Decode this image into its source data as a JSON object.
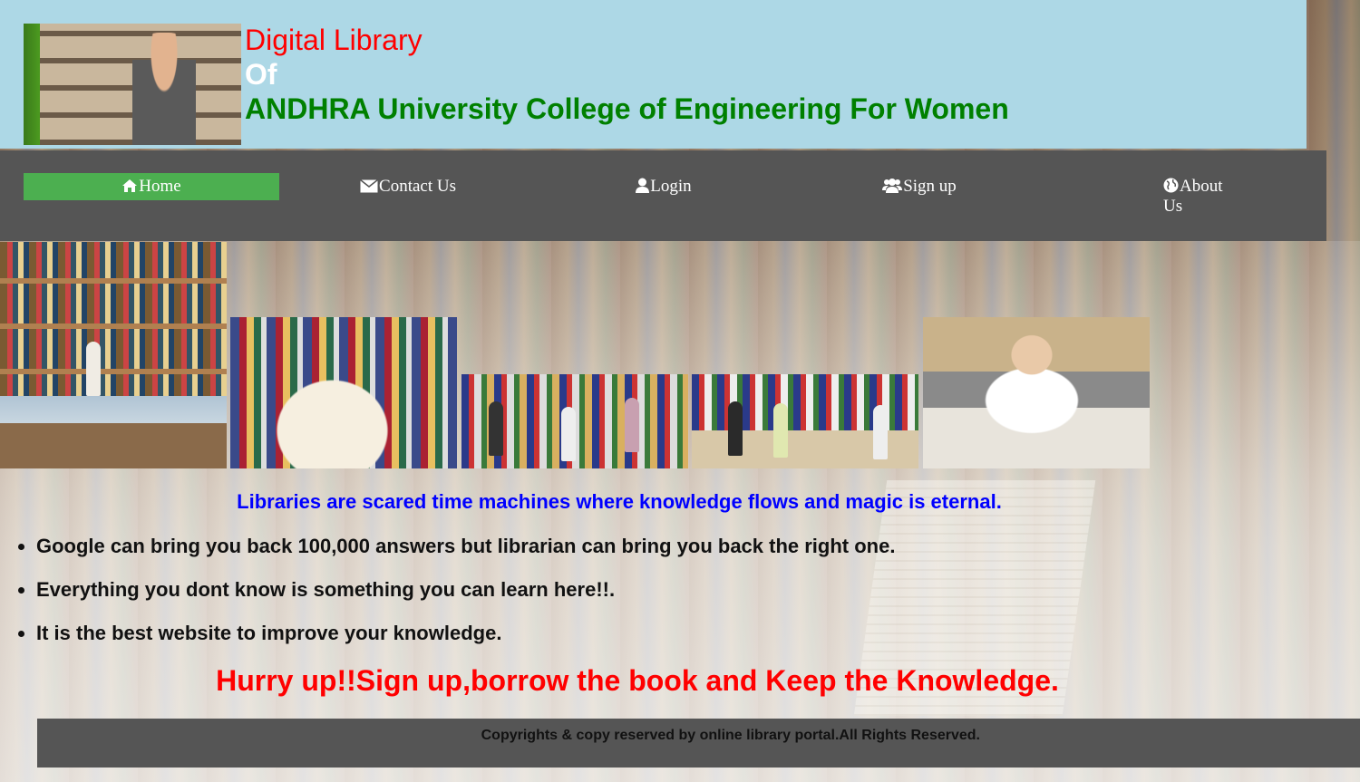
{
  "header": {
    "title_line1": "Digital Library",
    "title_line2": "Of",
    "title_line3": "ANDHRA University College of Engineering For Women",
    "logo_image": "woman-reading-in-library-photo"
  },
  "nav": {
    "items": [
      {
        "label": "Home",
        "icon": "home-icon",
        "active": true
      },
      {
        "label": "Contact Us",
        "icon": "envelope-icon",
        "active": false
      },
      {
        "label": "Login",
        "icon": "user-icon",
        "active": false
      },
      {
        "label": "Sign up",
        "icon": "users-icon",
        "active": false
      },
      {
        "label": "About Us",
        "icon": "globe-icon",
        "active": false
      }
    ],
    "active_color": "#4caf50",
    "bar_color": "#555555"
  },
  "gallery": [
    "woman-studying-at-library-table",
    "open-book-on-shelf",
    "students-browsing-bookshelves",
    "students-reading-at-table",
    "woman-studying-with-laptop"
  ],
  "main": {
    "quote": "Libraries are scared time machines where knowledge flows and magic is eternal.",
    "bullets": [
      "Google can bring you back 100,000 answers but librarian can bring you back the right one.",
      "Everything you dont know is something you can learn here!!.",
      "It is the best website to improve your knowledge."
    ],
    "call_to_action": "Hurry up!!Sign up,borrow the book and Keep the Knowledge."
  },
  "footer": {
    "text": "Copyrights & copy reserved by online library portal.All Rights Reserved."
  },
  "colors": {
    "header_bg": "#add8e6",
    "title_red": "#ff0000",
    "title_green": "#008000",
    "quote_blue": "#0000ff"
  }
}
